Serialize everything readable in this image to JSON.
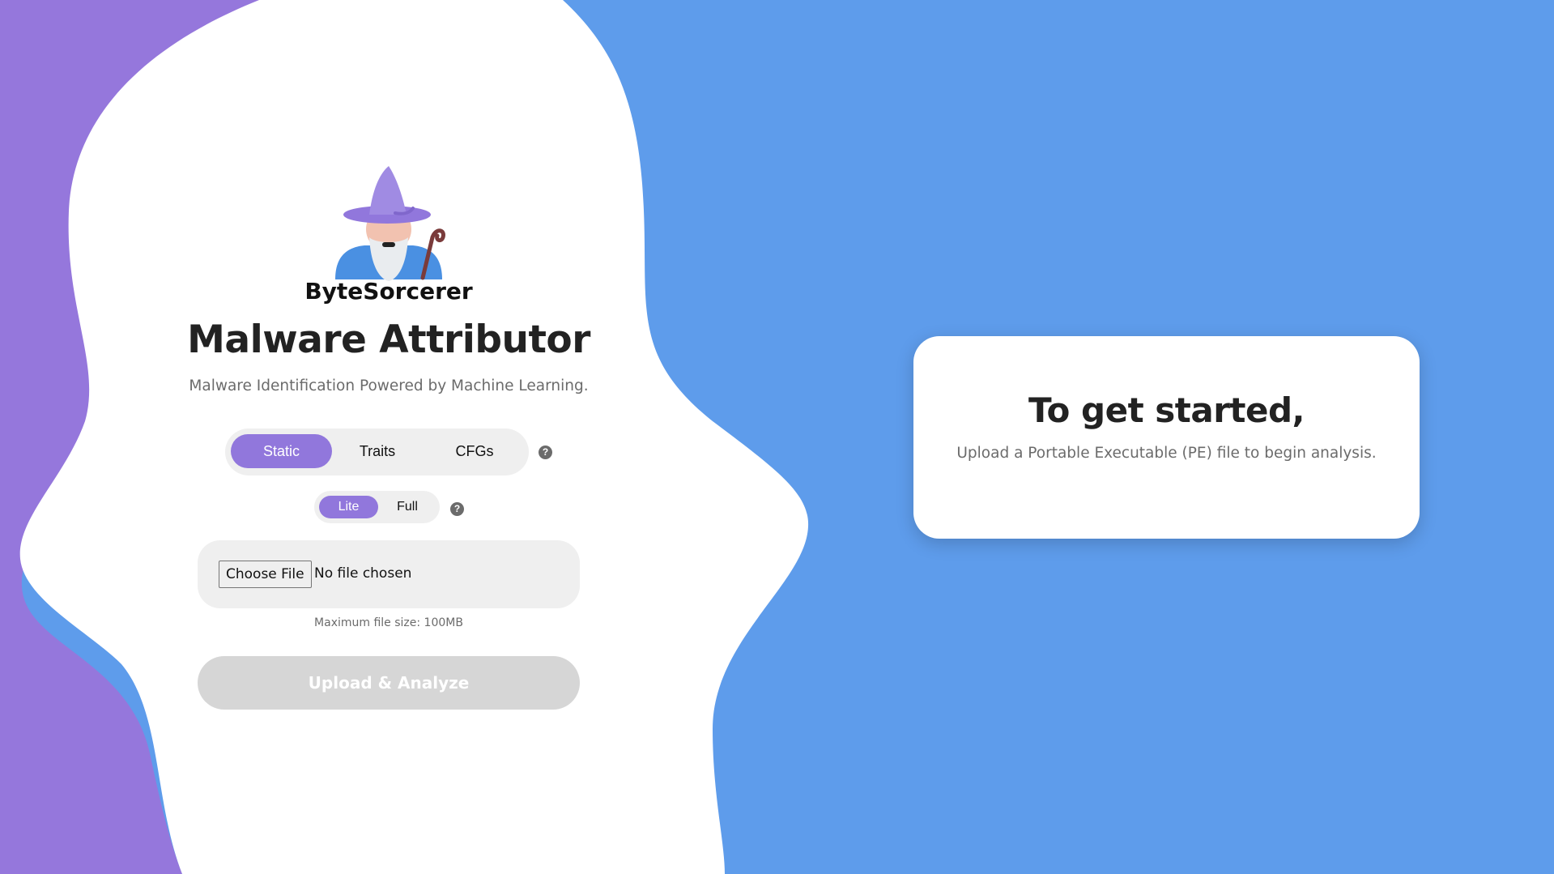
{
  "app": {
    "brand": "ByteSorcerer",
    "title": "Malware Attributor",
    "subtitle": "Malware Identification Powered by Machine Learning."
  },
  "colors": {
    "background_blue": "#5e9ceb",
    "background_purple": "#9577dc",
    "accent": "#9177dc",
    "disabled": "#d6d6d6"
  },
  "analysis_tabs": {
    "items": [
      {
        "label": "Static",
        "active": true
      },
      {
        "label": "Traits",
        "active": false
      },
      {
        "label": "CFGs",
        "active": false
      }
    ],
    "help_symbol": "?"
  },
  "mode_toggle": {
    "items": [
      {
        "label": "Lite",
        "active": true
      },
      {
        "label": "Full",
        "active": false
      }
    ],
    "help_symbol": "?"
  },
  "file_input": {
    "button_label": "Choose File",
    "status": "No file chosen",
    "max_size_note": "Maximum file size: 100MB"
  },
  "upload": {
    "label": "Upload & Analyze",
    "disabled": true
  },
  "info_card": {
    "title": "To get started,",
    "text": "Upload a Portable Executable (PE) file to begin analysis."
  },
  "icons": {
    "logo": "wizard-icon",
    "help": "question-circle-icon"
  }
}
